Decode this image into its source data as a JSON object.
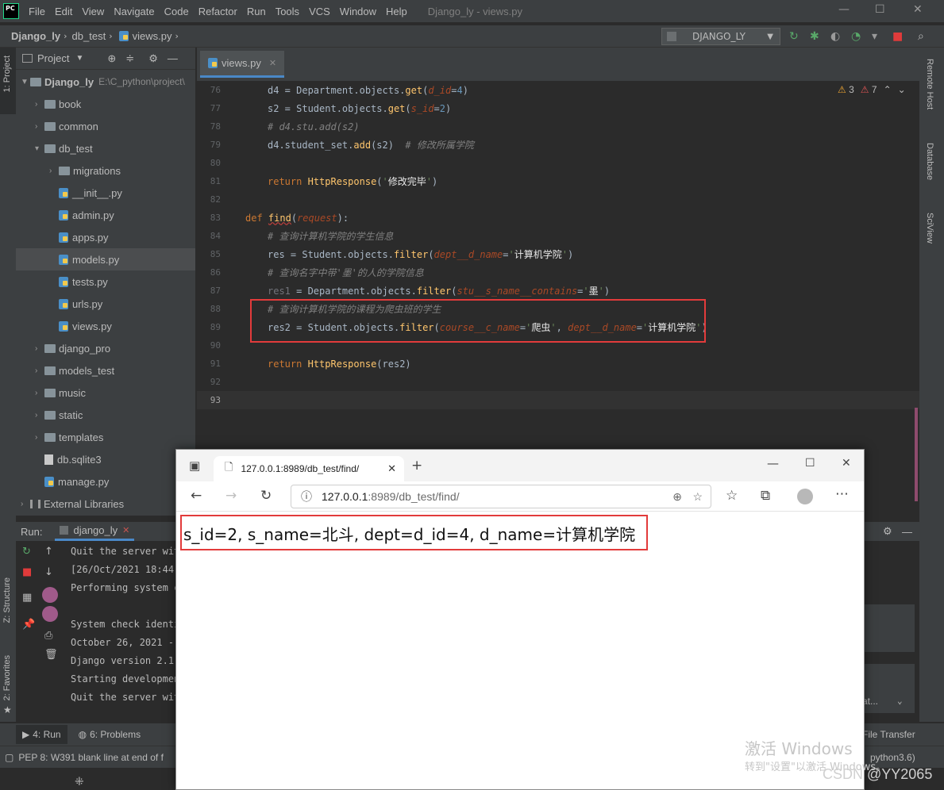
{
  "menubar": {
    "logo": "PC",
    "items": [
      "File",
      "Edit",
      "View",
      "Navigate",
      "Code",
      "Refactor",
      "Run",
      "Tools",
      "VCS",
      "Window",
      "Help"
    ],
    "window_title": "Django_ly - views.py"
  },
  "breadcrumb": {
    "project": "Django_ly",
    "folder": "db_test",
    "file": "views.py"
  },
  "run_config": {
    "label": "DJANGO_LY"
  },
  "project_panel": {
    "title": "Project",
    "root": "Django_ly",
    "root_path": "E:\\C_python\\project\\",
    "items": [
      {
        "label": "book",
        "type": "folder",
        "indent": 1
      },
      {
        "label": "common",
        "type": "folder",
        "indent": 1
      },
      {
        "label": "db_test",
        "type": "folder-open",
        "indent": 1
      },
      {
        "label": "migrations",
        "type": "folder",
        "indent": 2
      },
      {
        "label": "__init__.py",
        "type": "py",
        "indent": 2
      },
      {
        "label": "admin.py",
        "type": "py",
        "indent": 2
      },
      {
        "label": "apps.py",
        "type": "py",
        "indent": 2
      },
      {
        "label": "models.py",
        "type": "py",
        "indent": 2
      },
      {
        "label": "tests.py",
        "type": "py",
        "indent": 2
      },
      {
        "label": "urls.py",
        "type": "py",
        "indent": 2
      },
      {
        "label": "views.py",
        "type": "py",
        "indent": 2
      },
      {
        "label": "django_pro",
        "type": "folder",
        "indent": 1
      },
      {
        "label": "models_test",
        "type": "folder",
        "indent": 1
      },
      {
        "label": "music",
        "type": "folder",
        "indent": 1
      },
      {
        "label": "static",
        "type": "folder",
        "indent": 1
      },
      {
        "label": "templates",
        "type": "folder",
        "indent": 1
      },
      {
        "label": "db.sqlite3",
        "type": "db",
        "indent": 1
      },
      {
        "label": "manage.py",
        "type": "py",
        "indent": 1
      },
      {
        "label": "External Libraries",
        "type": "lib",
        "indent": 0
      }
    ]
  },
  "left_strip": {
    "project": "1: Project",
    "structure": "Z: Structure",
    "favorites": "2: Favorites"
  },
  "right_strip": {
    "remote": "Remote Host",
    "database": "Database",
    "sciview": "SciView"
  },
  "editor": {
    "tab": "views.py",
    "inspections": {
      "warnings": "3",
      "weak_warnings": "7"
    },
    "line_numbers": [
      "76",
      "77",
      "78",
      "79",
      "80",
      "81",
      "82",
      "83",
      "84",
      "85",
      "86",
      "87",
      "88",
      "89",
      "90",
      "91",
      "92",
      "93"
    ]
  },
  "run_panel": {
    "label": "Run:",
    "tab": "django_ly",
    "console_lines": [
      "Quit the server wit",
      "[26/Oct/2021 18:44:",
      "Performing system c",
      "",
      "System check identi",
      "October 26, 2021 -",
      "Django version 2.1.",
      "Starting development",
      "Quit the server wit"
    ]
  },
  "bottom_bar": {
    "run": "4: Run",
    "problems": "6: Problems",
    "file_transfer": "File Transfer",
    "right_partial": "at..."
  },
  "status_bar": {
    "message": "PEP 8: W391 blank line at end of f",
    "interpreter": "python3.6)"
  },
  "browser": {
    "tab_title": "127.0.0.1:8989/db_test/find/",
    "url_host": "127.0.0.1",
    "url_rest": ":8989/db_test/find/",
    "result": "s_id=2, s_name=北斗, dept=d_id=4, d_name=计算机学院"
  },
  "watermark": {
    "line1": "激活 Windows",
    "line2": "转到\"设置\"以激活 Windows。",
    "csdn": "CSDN @YY2065"
  }
}
